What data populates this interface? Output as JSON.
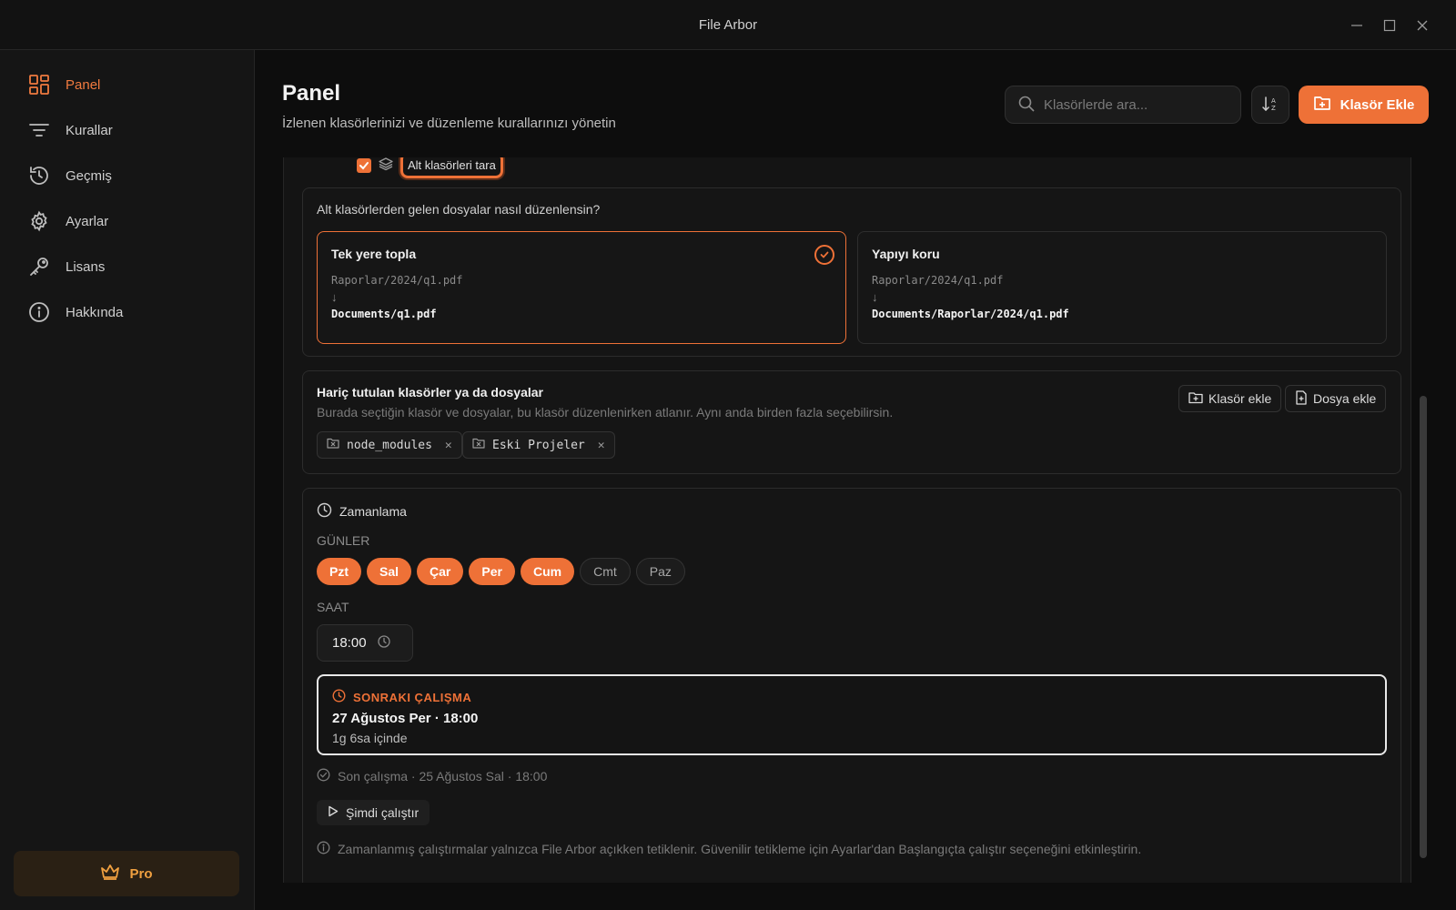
{
  "app": {
    "title": "File Arbor"
  },
  "sidebar": {
    "items": [
      {
        "label": "Panel",
        "icon": "dashboard-grid-icon",
        "active": true
      },
      {
        "label": "Kurallar",
        "icon": "filter-lines-icon"
      },
      {
        "label": "Geçmiş",
        "icon": "history-icon"
      },
      {
        "label": "Ayarlar",
        "icon": "gear-icon"
      },
      {
        "label": "Lisans",
        "icon": "key-icon"
      },
      {
        "label": "Hakkında",
        "icon": "info-icon"
      }
    ],
    "pro_label": "Pro"
  },
  "header": {
    "title": "Panel",
    "subtitle": "İzlenen klasörlerinizi ve düzenleme kurallarınızı yönetin",
    "search_placeholder": "Klasörlerde ara...",
    "add_folder_label": "Klasör Ekle"
  },
  "subfolder": {
    "scan_label": "Alt klasörleri tara",
    "checked": true,
    "question": "Alt klasörlerden gelen dosyalar nasıl düzenlensin?",
    "options": [
      {
        "title": "Tek yere topla",
        "from": "Raporlar/2024/q1.pdf",
        "arrow": "↓",
        "to": "Documents/q1.pdf",
        "selected": true
      },
      {
        "title": "Yapıyı koru",
        "from": "Raporlar/2024/q1.pdf",
        "arrow": "↓",
        "to": "Documents/Raporlar/2024/q1.pdf",
        "selected": false
      }
    ]
  },
  "excluded": {
    "title": "Hariç tutulan klasörler ya da dosyalar",
    "description": "Burada seçtiğin klasör ve dosyalar, bu klasör düzenlenirken atlanır. Aynı anda birden fazla seçebilirsin.",
    "add_folder_label": "Klasör ekle",
    "add_file_label": "Dosya ekle",
    "items": [
      "node_modules",
      "Eski Projeler"
    ]
  },
  "schedule": {
    "title": "Zamanlama",
    "days_label": "GÜNLER",
    "days": [
      {
        "label": "Pzt",
        "on": true
      },
      {
        "label": "Sal",
        "on": true
      },
      {
        "label": "Çar",
        "on": true
      },
      {
        "label": "Per",
        "on": true
      },
      {
        "label": "Cum",
        "on": true
      },
      {
        "label": "Cmt",
        "on": false
      },
      {
        "label": "Paz",
        "on": false
      }
    ],
    "time_label": "SAAT",
    "time": "18:00",
    "next_run_label": "SONRAKI ÇALIŞMA",
    "next_run_date": "27 Ağustos Per · 18:00",
    "next_run_relative": "1g 6sa içinde",
    "last_run": "Son çalışma · 25 Ağustos Sal · 18:00",
    "run_now_label": "Şimdi çalıştır",
    "note": "Zamanlanmış çalıştırmalar yalnızca File Arbor açıkken tetiklenir. Güvenilir tetikleme için Ayarlar'dan Başlangıçta çalıştır seçeneğini etkinleştirin."
  },
  "colors": {
    "accent": "#ee7137",
    "background": "#0d0d0d",
    "sidebar": "#151515"
  }
}
